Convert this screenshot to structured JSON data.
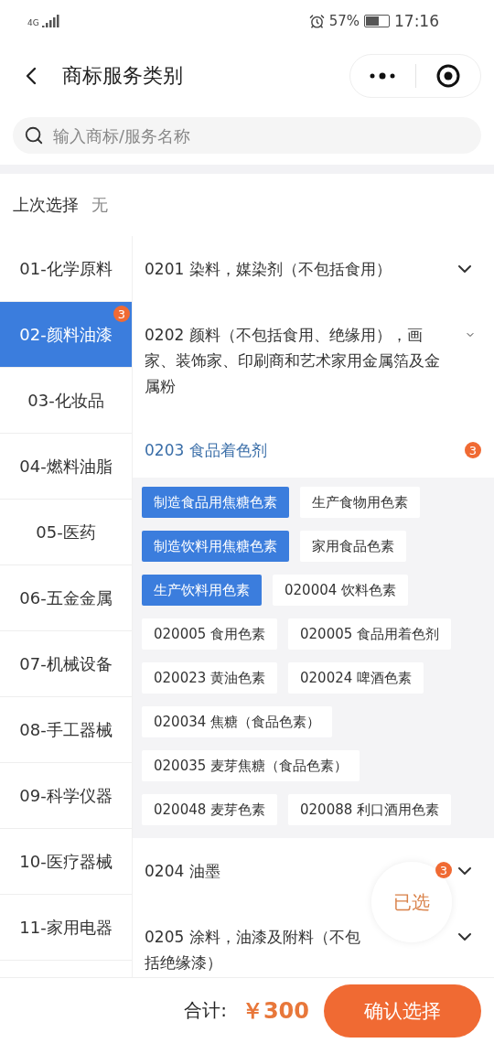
{
  "status_bar": {
    "network": "4G",
    "battery_text": "57%",
    "time": "17:16"
  },
  "header": {
    "title": "商标服务类别"
  },
  "search": {
    "placeholder": "输入商标/服务名称"
  },
  "last_selection": {
    "label": "上次选择",
    "value": "无"
  },
  "sidebar": {
    "items": [
      {
        "label": "01-化学原料",
        "selected": false
      },
      {
        "label": "02-颜料油漆",
        "selected": true,
        "badge": "3"
      },
      {
        "label": "03-化妆品",
        "selected": false
      },
      {
        "label": "04-燃料油脂",
        "selected": false
      },
      {
        "label": "05-医药",
        "selected": false
      },
      {
        "label": "06-五金金属",
        "selected": false
      },
      {
        "label": "07-机械设备",
        "selected": false
      },
      {
        "label": "08-手工器械",
        "selected": false
      },
      {
        "label": "09-科学仪器",
        "selected": false
      },
      {
        "label": "10-医疗器械",
        "selected": false
      },
      {
        "label": "11-家用电器",
        "selected": false
      }
    ]
  },
  "groups": [
    {
      "title": "0201 染料，媒染剂（不包括食用）",
      "expanded": false
    },
    {
      "title": "0202 颜料（不包括食用、绝缘用），画家、装饰家、印刷商和艺术家用金属箔及金属粉",
      "expanded": false
    },
    {
      "title": "0203 食品着色剂",
      "expanded": true,
      "badge": "3",
      "tags": [
        {
          "label": "制造食品用焦糖色素",
          "selected": true
        },
        {
          "label": "生产食物用色素",
          "selected": false
        },
        {
          "label": "制造饮料用焦糖色素",
          "selected": true
        },
        {
          "label": "家用食品色素",
          "selected": false
        },
        {
          "label": "生产饮料用色素",
          "selected": true
        },
        {
          "label": "020004 饮料色素",
          "selected": false
        },
        {
          "label": "020005 食用色素",
          "selected": false
        },
        {
          "label": "020005 食品用着色剂",
          "selected": false
        },
        {
          "label": "020023 黄油色素",
          "selected": false
        },
        {
          "label": "020024 啤酒色素",
          "selected": false
        },
        {
          "label": "020034 焦糖（食品色素）",
          "selected": false
        },
        {
          "label": "020035 麦芽焦糖（食品色素）",
          "selected": false
        },
        {
          "label": "020048 麦芽色素",
          "selected": false
        },
        {
          "label": "020088 利口酒用色素",
          "selected": false
        }
      ]
    },
    {
      "title": "0204 油墨",
      "expanded": false
    },
    {
      "title": "0205 涂料，油漆及附料（不包括绝缘漆）",
      "expanded": false
    }
  ],
  "floating_button": {
    "label": "已选",
    "badge": "3"
  },
  "footer": {
    "total_label": "合计:",
    "total_value": "￥300",
    "confirm": "确认选择"
  }
}
